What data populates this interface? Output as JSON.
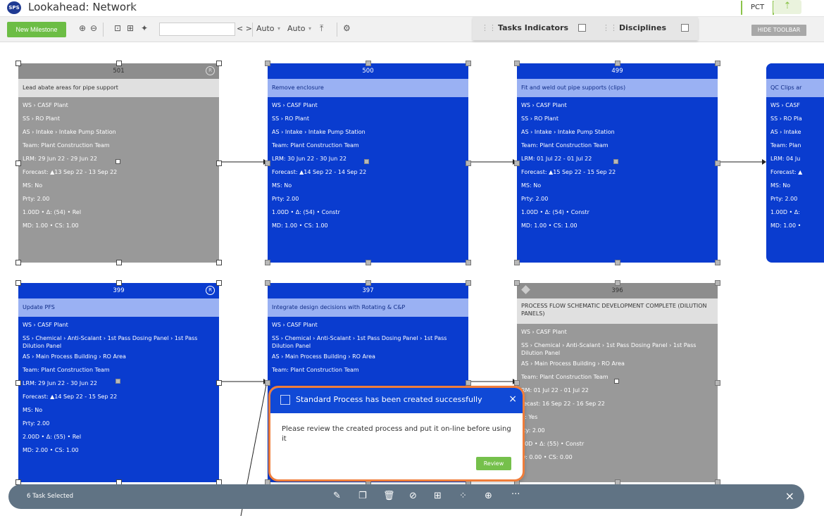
{
  "app": {
    "logo": "SPS",
    "title": "Lookahead: Network",
    "title_caret": "▾",
    "pct": "PCT",
    "user_icon": "user-check-icon"
  },
  "toolbar": {
    "new_milestone": "New Milestone",
    "search_value": "",
    "nav": "< >",
    "auto1": "Auto",
    "auto2": "Auto",
    "dropdown_caret": "▾",
    "tasks_indicators": "Tasks Indicators",
    "disciplines": "Disciplines",
    "hide_toolbar": "HIDE TOOLBAR"
  },
  "cards": [
    {
      "id": "501",
      "title": "Lead abate areas for pipe support",
      "badge": "R",
      "rows": [
        "WS › CASF Plant",
        "SS › RO Plant",
        "AS › Intake › Intake Pump Station",
        "Team: Plant Construction Team",
        "LRM: 29 Jun 22 - 29 Jun 22",
        "Forecast: ▲13 Sep 22 - 13 Sep 22",
        "MS: No",
        "Prty: 2.00",
        "1.00D • Δ: (54) • Rel",
        "MD: 1.00 • CS: 1.00"
      ]
    },
    {
      "id": "500",
      "title": "Remove enclosure",
      "rows": [
        "WS › CASF Plant",
        "SS › RO Plant",
        "AS › Intake › Intake Pump Station",
        "Team: Plant Construction Team",
        "LRM: 30 Jun 22 - 30 Jun 22",
        "Forecast: ▲14 Sep 22 - 14 Sep 22",
        "MS: No",
        "Prty: 2.00",
        "1.00D • Δ: (54) • Constr",
        "MD: 1.00 • CS: 1.00"
      ]
    },
    {
      "id": "499",
      "title": "Fit and weld out pipe supports (clips)",
      "rows": [
        "WS › CASF Plant",
        "SS › RO Plant",
        "AS › Intake › Intake Pump Station",
        "Team: Plant Construction Team",
        "LRM: 01 Jul 22 - 01 Jul 22",
        "Forecast: ▲15 Sep 22 - 15 Sep 22",
        "MS: No",
        "Prty: 2.00",
        "1.00D • Δ: (54) • Constr",
        "MD: 1.00 • CS: 1.00"
      ]
    },
    {
      "id": "",
      "title": "QC Clips ar",
      "rows": [
        "WS › CASF",
        "SS › RO Pla",
        "AS › Intake",
        "Team: Plan",
        "LRM: 04 Ju",
        "Forecast: ▲",
        "MS: No",
        "Prty: 2.00",
        "1.00D • Δ:",
        "MD: 1.00 •"
      ]
    },
    {
      "id": "399",
      "title": "Update PFS",
      "badge": "R",
      "rows": [
        "WS › CASF Plant",
        "SS › Chemical › Anti-Scalant › 1st Pass Dosing Panel › 1st Pass Dilution Panel",
        "AS › Main Process Building › RO Area",
        "Team: Plant Construction Team",
        "LRM: 29 Jun 22 - 30 Jun 22",
        "Forecast: ▲14 Sep 22 - 15 Sep 22",
        "MS: No",
        "Prty: 2.00",
        "2.00D • Δ: (55) • Rel",
        "MD: 2.00 • CS: 1.00"
      ]
    },
    {
      "id": "397",
      "title": "Integrate design decisions with Rotating & C&P",
      "rows": [
        "WS › CASF Plant",
        "SS › Chemical › Anti-Scalant › 1st Pass Dosing Panel › 1st Pass Dilution Panel",
        "AS › Main Process Building › RO Area",
        "Team: Plant Construction Team"
      ]
    },
    {
      "id": "396",
      "title": "PROCESS FLOW SCHEMATIC DEVELOPMENT COMPLETE (DILUTION PANELS)",
      "rows": [
        "WS › CASF Plant",
        "SS › Chemical › Anti-Scalant › 1st Pass Dosing Panel › 1st Pass Dilution Panel",
        "AS › Main Process Building › RO Area",
        "Team: Plant Construction Team",
        "RM: 01 Jul 22 - 01 Jul 22",
        "recast: 16 Sep 22 - 16 Sep 22",
        "S: Yes",
        "rty: 2.00",
        "00D • Δ: (55) • Constr",
        "D: 0.00 • CS: 0.00"
      ]
    }
  ],
  "notification": {
    "title": "Standard Process has been created successfully",
    "close": "×",
    "body": "Please review the created process and put it on-line before using it",
    "review": "Review"
  },
  "bottom_bar": {
    "label": "6 Task Selected",
    "more": "···",
    "close": "×"
  }
}
